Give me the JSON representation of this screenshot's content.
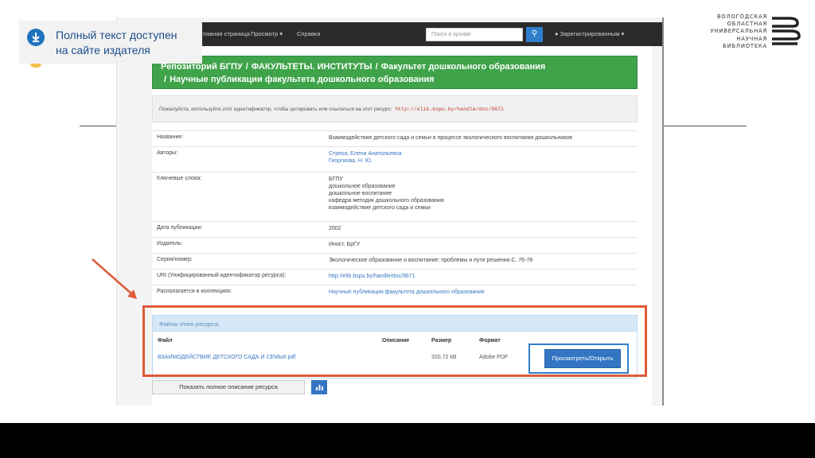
{
  "slide": {
    "callout_text_line1": "Полный текст доступен",
    "callout_text_line2": "на сайте издателя",
    "logo_lines": [
      "ВОЛОГОДСКАЯ",
      "ОБЛАСТНАЯ",
      "УНИВЕРСАЛЬНАЯ",
      "НАУЧНАЯ",
      "БИБЛИОТЕКА"
    ]
  },
  "navbar": {
    "home": "Главная страница",
    "browse": "Просмотр ▾",
    "help": "Справка",
    "search_placeholder": "Поиск в архиве",
    "user": "Зарегистрированным ▾"
  },
  "breadcrumb": {
    "items": [
      "Репозиторий БГПУ",
      "ФАКУЛЬТЕТЫ. ИНСТИТУТЫ",
      "Факультет дошкольного образования",
      "Научные публикации факультета дошкольного образования"
    ]
  },
  "notice": {
    "text": "Пожалуйста, используйте этот идентификатор, чтобы цитировать или ссылаться на этот ресурс:",
    "url": "http://elib.bspu.by/handle/doc/9671"
  },
  "metadata": [
    {
      "label": "Название:",
      "values": [
        "Взаимодействие детского сада и семьи в процессе экологического воспитания дошкольников"
      ]
    },
    {
      "label": "Авторы:",
      "values": [
        "Стреха, Елена Анатольевна",
        "Гиоргиова, Н. Ю."
      ]
    },
    {
      "label": "Ключевые слова:",
      "values": [
        "БГПУ",
        "дошкольное образование",
        "дошкольное воспитание",
        "кафедра методик дошкольного образования",
        "взаимодействие детского сада и семьи"
      ]
    },
    {
      "label": "Дата публикации:",
      "values": [
        "2002"
      ]
    },
    {
      "label": "Издатель:",
      "values": [
        "Иност. БрГУ"
      ]
    },
    {
      "label": "Серия/номер:",
      "values": [
        "Экологическое образование и воспитание: проблемы и пути решения.С. 76-78"
      ]
    },
    {
      "label": "URI (Унифицированный идентификатор ресурса):",
      "values": [
        "http://elib.bspu.by/handle/doc/9671"
      ]
    },
    {
      "label": "Располагается в коллекциях:",
      "values": [
        "Научные публикации факультета дошкольного образования"
      ]
    }
  ],
  "files": {
    "header": "Файлы этого ресурса:",
    "columns": [
      "Файл",
      "Описание",
      "Размер",
      "Формат"
    ],
    "rows": [
      {
        "file": "ВЗАИМОДЕЙСТВИЕ ДЕТСКОГО САДА И СЕМЬИ.pdf",
        "description": "",
        "size": "320,72 kB",
        "format": "Adobe PDF"
      }
    ],
    "view_button": "Просмотреть/Открыть"
  },
  "buttons": {
    "full_description": "Показать полное описание ресурса",
    "stats_icon": "bar-chart-icon"
  },
  "colors": {
    "accent_green": "#3fa34a",
    "link_blue": "#3a78c2",
    "highlight_orange": "#e05a38",
    "button_blue": "#3375c3"
  }
}
